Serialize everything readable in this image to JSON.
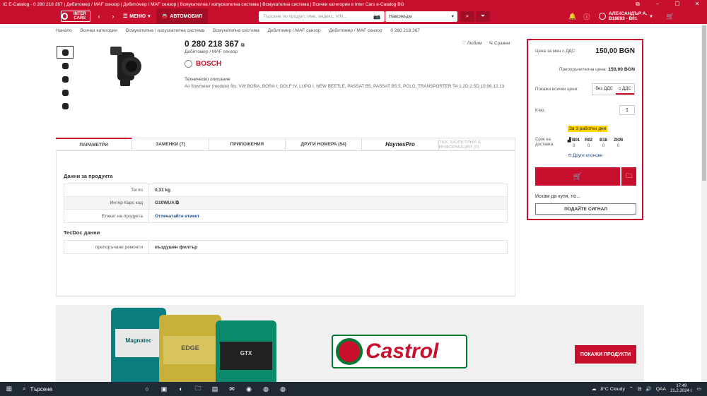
{
  "window": {
    "title": "IC E-Catalog - 0 280 218 367 | Дебитомер / MAF сензор | Дебитомер / MAF сензор | Всмукателна / изпускателна система | Всмукателна система | Всички категории в Inter Cars e-Catalog BG"
  },
  "nav": {
    "logo_text": "INTER CARS",
    "menu_label": "МЕНЮ",
    "auto_label": "АВТОМОБИЛ",
    "search_placeholder": "Търсене по продукт, име, индекс, VIN...",
    "scope_value": "Навсякъде",
    "user_name": "АЛЕКСАНДЪР А.",
    "user_code": "B18893 - B01"
  },
  "breadcrumbs": [
    "Начало",
    "Всички категории",
    "Всмукателна / изпускателна система",
    "Всмукателна система",
    "Дебитомер / MAF сензор",
    "Дебитомер / MAF сензор",
    "0 280 218 367"
  ],
  "product": {
    "code": "0 280 218 367",
    "subtitle": "Дебитомер / MAF сензор",
    "brand": "BOSCH",
    "tech_label": "Техническо описание",
    "tech_value": "Air flowmeter (module) fits: VW BORA, BORA I, GOLF IV, LUPO I, NEW BEETLE, PASSAT B5, PASSAT B5.5, POLO, TRANSPORTER T4 1.2D-2.5D 10.96-12.13",
    "favorite_label": "Любим",
    "compare_label": "Сравни"
  },
  "tabs": [
    "ПАРАМЕТРИ",
    "ЗАМЕНКИ (7)",
    "ПРИЛОЖЕНИЯ",
    "ДРУГИ НОМЕРА (54)",
    "HaynesPro",
    "ТЕХ. БЮЛЕТИНИ & ИНФОРМАЦИЯ (0)"
  ],
  "params": {
    "section1_title": "Данни за продукта",
    "rows1": [
      {
        "k": "Тегло",
        "v": "0,31 kg"
      },
      {
        "k": "Интер Карс код",
        "v": "G10WUA"
      },
      {
        "k": "Етикет на продукта",
        "v": "Отпечатайте етикет"
      }
    ],
    "section2_title": "TecDoc данни",
    "rows2": [
      {
        "k": "препоръчани ремонти",
        "v": "въздушен филтър"
      }
    ]
  },
  "price": {
    "net_label": "Цена за мен с ДДС:",
    "net_value": "150,00 BGN",
    "rec_label": "Препоръчителна цена:",
    "rec_value": "150,00 BGN",
    "show_label": "Покажи всички цени:",
    "toggle_without": "без ДДС",
    "toggle_with": "с ДДС",
    "qty_label": "К-во:",
    "qty_value": "1",
    "delivery_badge": "За 3 работни дни",
    "delivery_label": "Срок на доставка:",
    "warehouses": [
      {
        "name": "B01",
        "qty": "0"
      },
      {
        "name": "R02",
        "qty": "0"
      },
      {
        "name": "B18",
        "qty": "0"
      },
      {
        "name": "ZKM",
        "qty": "0"
      }
    ],
    "clones_label": "Други клонове",
    "want_label": "Искам да купя, но...",
    "signal_label": "ПОДАЙТЕ СИГНАЛ"
  },
  "banner": {
    "brand_text": "Castrol",
    "button_label": "ПОКАЖИ ПРОДУКТИ",
    "cans": [
      "Magnatec",
      "EDGE",
      "GTX"
    ]
  },
  "taskbar": {
    "search_label": "Търсене",
    "weather": "8°C  Cloudy",
    "lang": "QAA",
    "time": "17:49",
    "date": "21.2.2024 г."
  },
  "colors": {
    "brand_red": "#c8102e",
    "castrol_green": "#007a33",
    "badge_yellow": "#ffd400"
  }
}
